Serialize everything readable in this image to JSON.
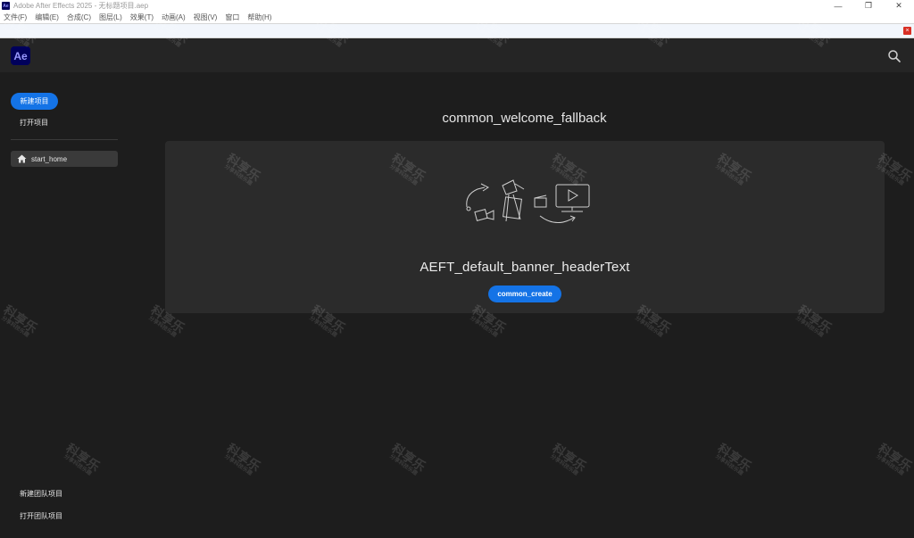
{
  "window": {
    "title": "Adobe After Effects 2025 - 无标题项目.aep",
    "app_icon_label": "Ae",
    "controls": {
      "minimize": "—",
      "restore": "❐",
      "close": "✕"
    }
  },
  "menubar": [
    "文件(F)",
    "编辑(E)",
    "合成(C)",
    "图层(L)",
    "效果(T)",
    "动画(A)",
    "视图(V)",
    "窗口",
    "帮助(H)"
  ],
  "notice": {
    "close_label": "×"
  },
  "header": {
    "logo_label": "Ae",
    "search_icon": "search-icon"
  },
  "sidebar": {
    "new_project": "新建项目",
    "open_project": "打开项目",
    "nav_home": "start_home",
    "new_team_project": "新建团队项目",
    "open_team_project": "打开团队项目"
  },
  "main": {
    "welcome_title": "common_welcome_fallback",
    "banner_header": "AEFT_default_banner_headerText",
    "create_button": "common_create"
  },
  "watermark": {
    "line1": "科享乐",
    "line2": "分享科技乐趣"
  },
  "colors": {
    "accent": "#1473e6",
    "background": "#1d1d1d",
    "logo_bg": "#00005b",
    "logo_fg": "#9999ff"
  }
}
